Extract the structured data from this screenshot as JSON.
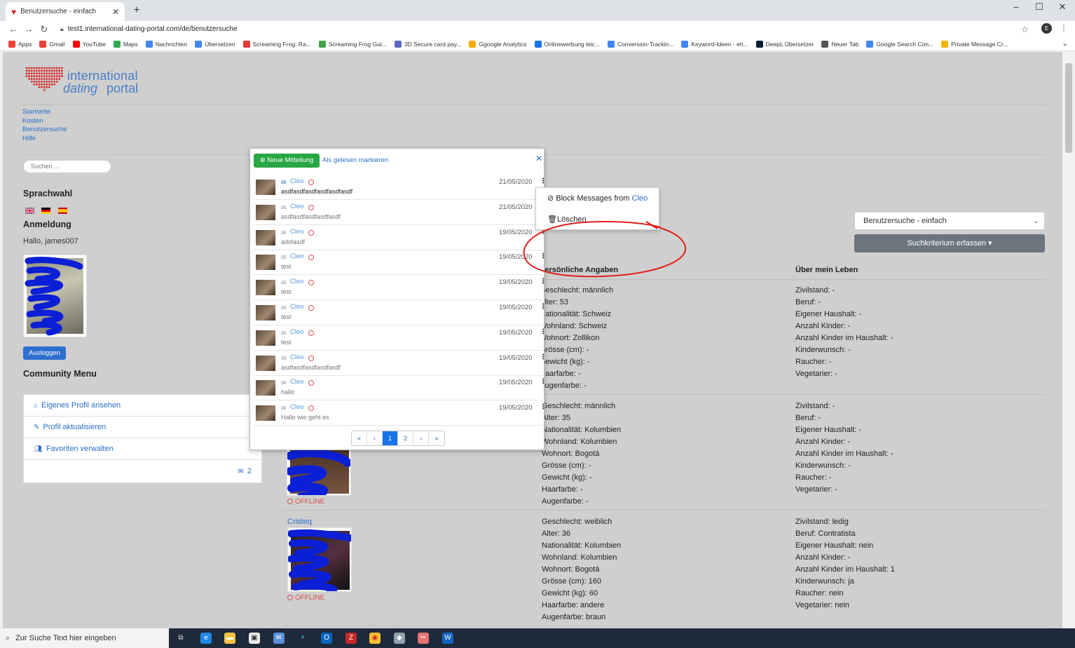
{
  "browser": {
    "tab_title": "Benutzersuche - einfach",
    "url": "test1.international-dating-portal.com/de/benutzersuche",
    "profile_initial": "E",
    "bookmarks": [
      "Apps",
      "Gmail",
      "YouTube",
      "Maps",
      "Nachrichten",
      "Übersetzen",
      "Screaming Frog: Ra...",
      "Screaming Frog Gui...",
      "3D Secure card pay...",
      "Ggoogle Analytics",
      "Onlinewerbung leic...",
      "Conversion-Trackin...",
      "Keyword-Ideen - eh...",
      "DeepL Übersetzer",
      "Neuer Tab",
      "Google Search Con...",
      "Private Message Cr..."
    ]
  },
  "logo": {
    "line1": "international",
    "line2a": "dating",
    "line2b": "portal"
  },
  "nav": [
    "Startseite",
    "Kosten",
    "Benutzersuche",
    "Hilfe"
  ],
  "search": {
    "placeholder": "Suchen ..."
  },
  "sidebar": {
    "lang_title": "Sprachwahl",
    "login_title": "Anmeldung",
    "greeting": "Hallo, james007",
    "logout": "Ausloggen",
    "community_title": "Community Menu",
    "community_items": [
      "Eigenes Profil ansehen",
      "Profil aktualisieren",
      "Favoriten verwalten"
    ],
    "message_count": "2"
  },
  "right": {
    "select_value": "Benutzersuche - einfach",
    "criteria_button": "Suchkriterium erfassen",
    "col_personal": "Persönliche Angaben",
    "col_life": "Über mein Leben"
  },
  "users": [
    {
      "name": "",
      "status": "",
      "personal": [
        "Geschlecht: männlich",
        "Alter: 53",
        "Nationalität: Schweiz",
        "Wohnland: Schweiz",
        "Wohnort: Zollikon",
        "Grösse (cm): -",
        "Gewicht (kg): -",
        "Haarfarbe: -",
        "Augenfarbe: -"
      ],
      "life": [
        "Zivilstand: -",
        "Beruf: -",
        "Eigener Haushalt: -",
        "Anzahl Kinder: -",
        "Anzahl Kinder im Haushalt: -",
        "Kinderwunsch: -",
        "Raucher: -",
        "Vegetarier: -"
      ]
    },
    {
      "name": "",
      "status": "OFFLINE",
      "personal": [
        "Geschlecht: männlich",
        "Alter: 35",
        "Nationalität: Kolumbien",
        "Wohnland: Kolumbien",
        "Wohnort: Bogotá",
        "Grösse (cm): -",
        "Gewicht (kg): -",
        "Haarfarbe: -",
        "Augenfarbe: -"
      ],
      "life": [
        "Zivilstand: -",
        "Beruf: -",
        "Eigener Haushalt: -",
        "Anzahl Kinder: -",
        "Anzahl Kinder im Haushalt: -",
        "Kinderwunsch: -",
        "Raucher: -",
        "Vegetarier: -"
      ]
    },
    {
      "name": "Cristeq",
      "status": "OFFLINE",
      "personal": [
        "Geschlecht: weiblich",
        "Alter: 36",
        "Nationalität: Kolumbien",
        "Wohnland: Kolumbien",
        "Wohnort: Bogotá",
        "Grösse (cm): 160",
        "Gewicht (kg): 60",
        "Haarfarbe: andere",
        "Augenfarbe: braun"
      ],
      "life": [
        "Zivilstand: ledig",
        "Beruf: Contratista",
        "Eigener Haushalt: nein",
        "Anzahl Kinder: -",
        "Anzahl Kinder im Haushalt: 1",
        "Kinderwunsch: ja",
        "Raucher: nein",
        "Vegetarier: nein"
      ]
    }
  ],
  "popup": {
    "new_message": "Neue Mitteilung",
    "mark_read": "Als gelesen markieren",
    "messages": [
      {
        "sender": "Cleo",
        "date": "21/05/2020",
        "text": "asdfasdfasdfasdfasdfasdf",
        "unread": true
      },
      {
        "sender": "Cleo",
        "date": "21/05/2020",
        "text": "asdfasdfasdfasdfasdf",
        "unread": false
      },
      {
        "sender": "Cleo",
        "date": "19/05/2020",
        "text": "adsfasdf",
        "unread": false
      },
      {
        "sender": "Cleo",
        "date": "19/05/2020",
        "text": "test",
        "unread": false
      },
      {
        "sender": "Cleo",
        "date": "19/05/2020",
        "text": "test",
        "unread": false
      },
      {
        "sender": "Cleo",
        "date": "19/05/2020",
        "text": "test",
        "unread": false
      },
      {
        "sender": "Cleo",
        "date": "19/05/2020",
        "text": "test",
        "unread": false
      },
      {
        "sender": "Cleo",
        "date": "19/05/2020",
        "text": "asdfasdfasdfasdfasdf",
        "unread": false
      },
      {
        "sender": "Cleo",
        "date": "19/05/2020",
        "text": "hallo",
        "unread": false
      },
      {
        "sender": "Cleo",
        "date": "19/05/2020",
        "text": "Hallo wie geht es",
        "unread": false
      }
    ],
    "pages": [
      "«",
      "‹",
      "1",
      "2",
      "›",
      "»"
    ]
  },
  "dropdown": {
    "block_prefix": "Block Messages from",
    "block_name": "Cleo",
    "delete": "Löschen"
  },
  "taskbar": {
    "search_placeholder": "Zur Suche Text hier eingeben"
  },
  "colors": {
    "link": "#2a6fc9",
    "green": "#28a745",
    "offline": "#d9534f",
    "logo_red": "#d62b2b",
    "annotation": "#e0201b",
    "scribble": "#0b1fd6"
  }
}
